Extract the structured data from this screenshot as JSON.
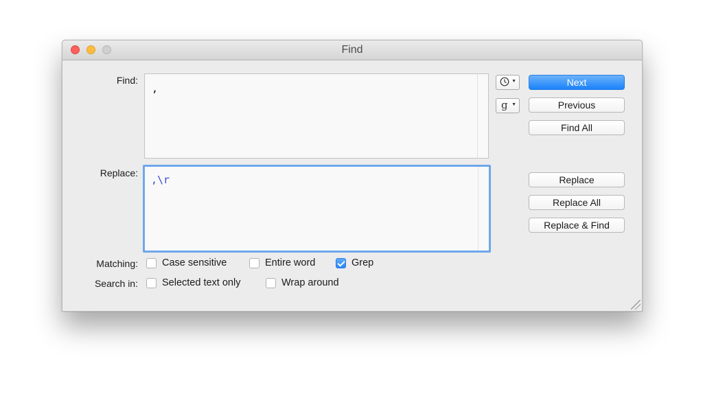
{
  "window": {
    "title": "Find"
  },
  "find": {
    "label": "Find:",
    "value": ","
  },
  "replace": {
    "label": "Replace:",
    "value": ",\\r"
  },
  "popups": {
    "history_icon": "clock-icon",
    "grep_glyph": "g"
  },
  "buttons": {
    "next": "Next",
    "previous": "Previous",
    "find_all": "Find All",
    "replace": "Replace",
    "replace_all": "Replace All",
    "replace_and_find": "Replace & Find"
  },
  "matching": {
    "label": "Matching:",
    "options": [
      {
        "label": "Case sensitive",
        "checked": false
      },
      {
        "label": "Entire word",
        "checked": false
      },
      {
        "label": "Grep",
        "checked": true
      }
    ]
  },
  "search_in": {
    "label": "Search in:",
    "options": [
      {
        "label": "Selected text only",
        "checked": false
      },
      {
        "label": "Wrap around",
        "checked": false
      }
    ]
  },
  "colors": {
    "accent": "#1a82fb",
    "focus_ring": "#6ea6ea",
    "grep_text": "#3a4bd6"
  }
}
